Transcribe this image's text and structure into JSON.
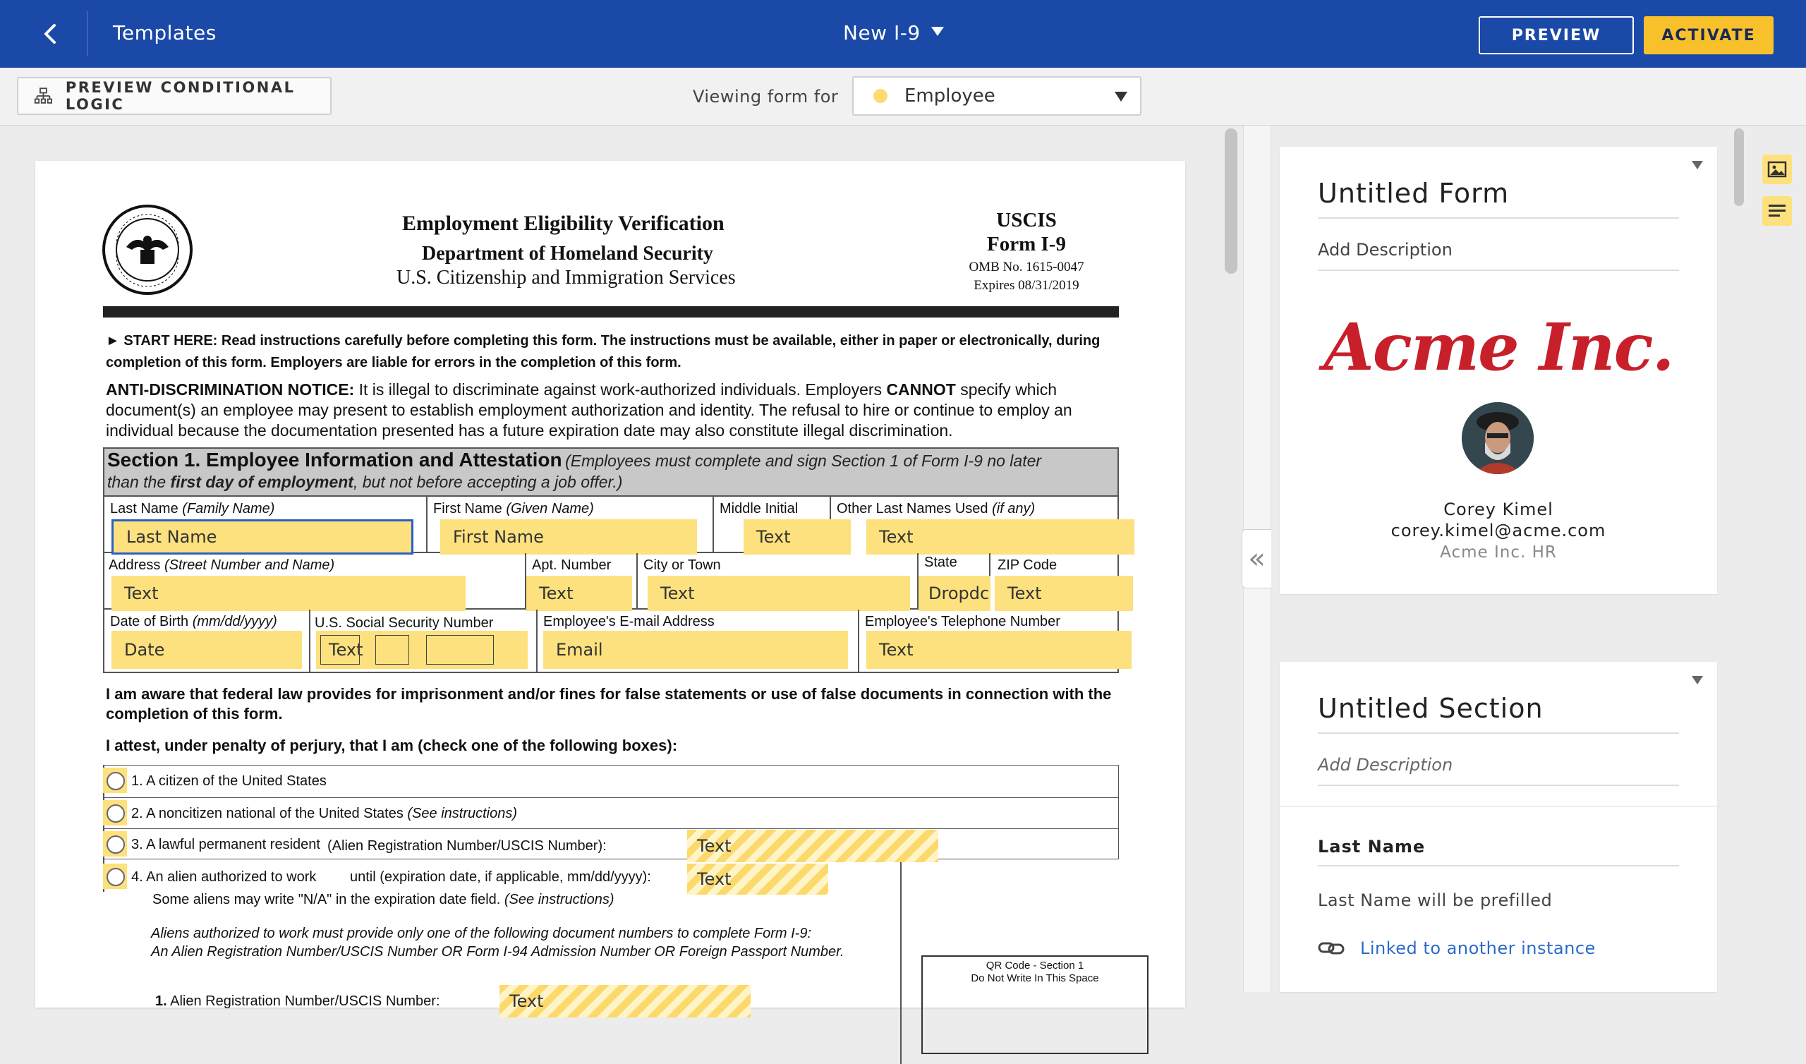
{
  "topbar": {
    "back_icon": "chevron-left-icon",
    "templates_label": "Templates",
    "form_name": "New I-9",
    "preview_label": "PREVIEW",
    "activate_label": "ACTIVATE",
    "colors": {
      "bar": "#1a49a8",
      "activate": "#f8c12c"
    }
  },
  "subbar": {
    "conditional_logic_label": "PREVIEW CONDITIONAL LOGIC",
    "viewing_label": "Viewing form for",
    "role_value": "Employee"
  },
  "form": {
    "header": {
      "title": "Employment Eligibility Verification",
      "dept": "Department of Homeland Security",
      "agency": "U.S. Citizenship and Immigration Services",
      "right1": "USCIS",
      "right2": "Form I-9",
      "omb": "OMB No. 1615-0047",
      "expires": "Expires 08/31/2019"
    },
    "start_here_label": "START HERE:",
    "start_here_text": "Read instructions carefully before completing this form. The instructions must be available, either in paper or electronically, during completion of this form. Employers are liable for errors in the completion of this form.",
    "anti_label": "ANTI-DISCRIMINATION NOTICE:",
    "anti_text1": "It is illegal to discriminate against work-authorized individuals. Employers",
    "anti_cannot": "CANNOT",
    "anti_text2": "specify which document(s) an employee may present to establish employment authorization and identity. The refusal to hire or continue to employ an individual because the documentation presented has a future expiration date may also constitute illegal discrimination.",
    "section1": {
      "title": "Section 1. Employee Information and Attestation",
      "note1": "(Employees must complete and sign Section 1 of Form I-9 no later",
      "note2a": "than the",
      "note2b": "first day of employment",
      "note2c": ", but not before accepting a job offer.)"
    },
    "labels": {
      "last_name": "Last Name",
      "last_name_i": "(Family Name)",
      "first_name": "First Name",
      "first_name_i": "(Given Name)",
      "middle": "Middle Initial",
      "other_names": "Other Last Names Used",
      "other_names_i": "(if any)",
      "address": "Address",
      "address_i": "(Street Number and Name)",
      "apt": "Apt. Number",
      "city": "City or Town",
      "state": "State",
      "zip": "ZIP Code",
      "dob": "Date of Birth",
      "dob_i": "(mm/dd/yyyy)",
      "ssn": "U.S. Social Security Number",
      "email": "Employee's E-mail Address",
      "phone": "Employee's Telephone Number"
    },
    "fields": {
      "last_name": "Last Name",
      "first_name": "First Name",
      "middle": "Text",
      "other_names": "Text",
      "address": "Text",
      "apt": "Text",
      "city": "Text",
      "state": "Dropdc",
      "zip": "Text",
      "dob": "Date",
      "ssn": "Text",
      "email": "Email",
      "phone": "Text"
    },
    "aware_text": "I am aware that federal law provides for imprisonment and/or fines for false statements or use of false documents in connection with the completion of this form.",
    "attest_text": "I attest, under penalty of perjury, that I am (check one of the following boxes):",
    "options": {
      "o1": "1. A citizen of the United States",
      "o2": "2. A noncitizen national of the United States",
      "o2_i": "(See instructions)",
      "o3": "3. A lawful permanent resident",
      "o3_b": "(Alien Registration Number/USCIS Number):",
      "o3_field": "Text",
      "o4": "4. An alien authorized to work",
      "o4_b": "until (expiration date, if applicable, mm/dd/yyyy):",
      "o4_field": "Text",
      "o4_c": "Some aliens may write \"N/A\" in the expiration date field.",
      "o4_c_i": "(See instructions)"
    },
    "aliens_note1": "Aliens authorized to work must provide only one of the following document numbers to complete Form I-9:",
    "aliens_note2": "An Alien Registration Number/USCIS Number OR Form I-94 Admission Number OR Foreign Passport Number.",
    "qr_line1": "QR Code - Section 1",
    "qr_line2": "Do Not Write In This Space",
    "alien1_num": "1.",
    "alien1_label": "Alien Registration Number/USCIS Number:",
    "alien1_field": "Text"
  },
  "panel": {
    "collapse_icon": "double-chevron-left-icon",
    "card1": {
      "title": "Untitled Form",
      "description": "Add Description",
      "logo_text": "Acme Inc.",
      "user_name": "Corey Kimel",
      "user_email": "corey.kimel@acme.com",
      "user_org": "Acme Inc. HR"
    },
    "card2": {
      "title": "Untitled Section",
      "description": "Add Description",
      "field_label": "Last Name",
      "prefill_note": "Last Name will be prefilled",
      "linked_label": "Linked to another instance"
    },
    "side_icons": [
      "image-icon",
      "text-lines-icon"
    ]
  }
}
